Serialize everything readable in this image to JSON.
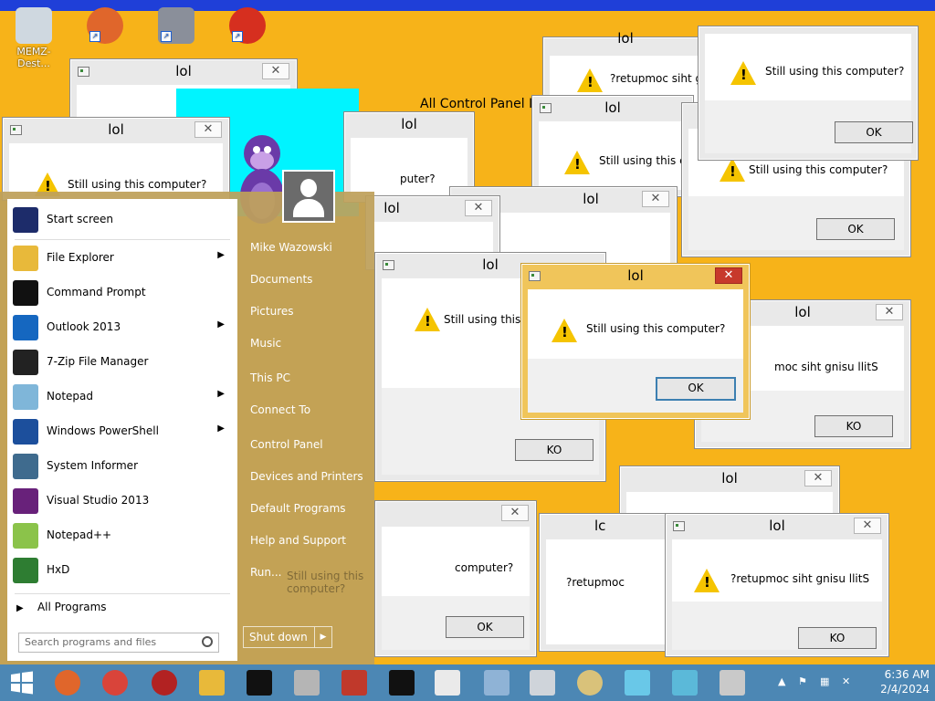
{
  "desktop": {
    "icons": [
      {
        "label": "MEMZ-Dest..."
      },
      {
        "label": ""
      },
      {
        "label": ""
      },
      {
        "label": ""
      }
    ]
  },
  "control_panel_title": "All Control Panel It",
  "dialogs": [
    {
      "id": "d1",
      "title": "lol",
      "message": "",
      "button": ""
    },
    {
      "id": "d2",
      "title": "lol",
      "message": "Still using this computer?",
      "button": ""
    },
    {
      "id": "d3",
      "title": "lol",
      "message": "puter?",
      "button": ""
    },
    {
      "id": "d4",
      "title": "lol",
      "message": "",
      "button": ""
    },
    {
      "id": "d5",
      "title": "lol",
      "message": "?retupmoc siht gnisu llitS",
      "button": ""
    },
    {
      "id": "d6",
      "title": "lol",
      "message": "Still using this computer?",
      "button": "OK"
    },
    {
      "id": "d7",
      "title": "lol",
      "message": "Still using this co",
      "button": ""
    },
    {
      "id": "d8",
      "title": "lol",
      "message": "Still using this computer?",
      "button": "OK"
    },
    {
      "id": "d9",
      "title": "lol",
      "message": "",
      "button": ""
    },
    {
      "id": "d10",
      "title": "lol",
      "message": "Still using this co",
      "button": "KO"
    },
    {
      "id": "d11",
      "title": "lol",
      "message": "Still using this computer?",
      "button": "OK"
    },
    {
      "id": "d12",
      "title": "lol",
      "message": "moc siht gnisu llitS",
      "button": "KO"
    },
    {
      "id": "d13",
      "title": "lol",
      "message": "",
      "button": ""
    },
    {
      "id": "d14",
      "title": "",
      "message": "computer?",
      "button": "OK"
    },
    {
      "id": "d15",
      "title": "lc",
      "message": "?retupmoc",
      "button": ""
    },
    {
      "id": "d16",
      "title": "lol",
      "message": "?retupmoc siht gnisu llitS",
      "button": "KO"
    }
  ],
  "ghost_texts": {
    "still_using_ghost": "Still using this computer?",
    "ok_ghost": "OK",
    "lol_ghost": "lol",
    "retup_ghost": "?retupmoc"
  },
  "start_menu": {
    "pinned": [
      {
        "label": "Start screen",
        "icon": "start-screen-icon",
        "arrow": false,
        "color": "#1d2c6a"
      },
      {
        "label": "File Explorer",
        "icon": "folder-icon",
        "arrow": true,
        "color": "#e8b93a"
      },
      {
        "label": "Command Prompt",
        "icon": "cmd-icon",
        "arrow": false,
        "color": "#111111"
      },
      {
        "label": "Outlook 2013",
        "icon": "outlook-icon",
        "arrow": true,
        "color": "#1567c0"
      },
      {
        "label": "7-Zip File Manager",
        "icon": "7zip-icon",
        "arrow": false,
        "color": "#222222"
      },
      {
        "label": "Notepad",
        "icon": "notepad-icon",
        "arrow": true,
        "color": "#7fb6d9"
      },
      {
        "label": "Windows PowerShell",
        "icon": "powershell-icon",
        "arrow": true,
        "color": "#1c4f9c"
      },
      {
        "label": "System Informer",
        "icon": "system-informer-icon",
        "arrow": false,
        "color": "#3f6b8e"
      },
      {
        "label": "Visual Studio 2013",
        "icon": "visual-studio-icon",
        "arrow": false,
        "color": "#68217a"
      },
      {
        "label": "Notepad++",
        "icon": "notepadpp-icon",
        "arrow": false,
        "color": "#8bc34a"
      },
      {
        "label": "HxD",
        "icon": "hxd-icon",
        "arrow": false,
        "color": "#2e7d32"
      }
    ],
    "all_programs": "All Programs",
    "search_placeholder": "Search programs and files",
    "right_items": [
      "Mike Wazowski",
      "Documents",
      "Pictures",
      "Music",
      "This PC",
      "Connect To",
      "Control Panel",
      "Devices and Printers",
      "Default Programs",
      "Help and Support",
      "Run..."
    ],
    "shutdown_label": "Shut down"
  },
  "taskbar": {
    "time": "6:36 AM",
    "date": "2/4/2024"
  }
}
